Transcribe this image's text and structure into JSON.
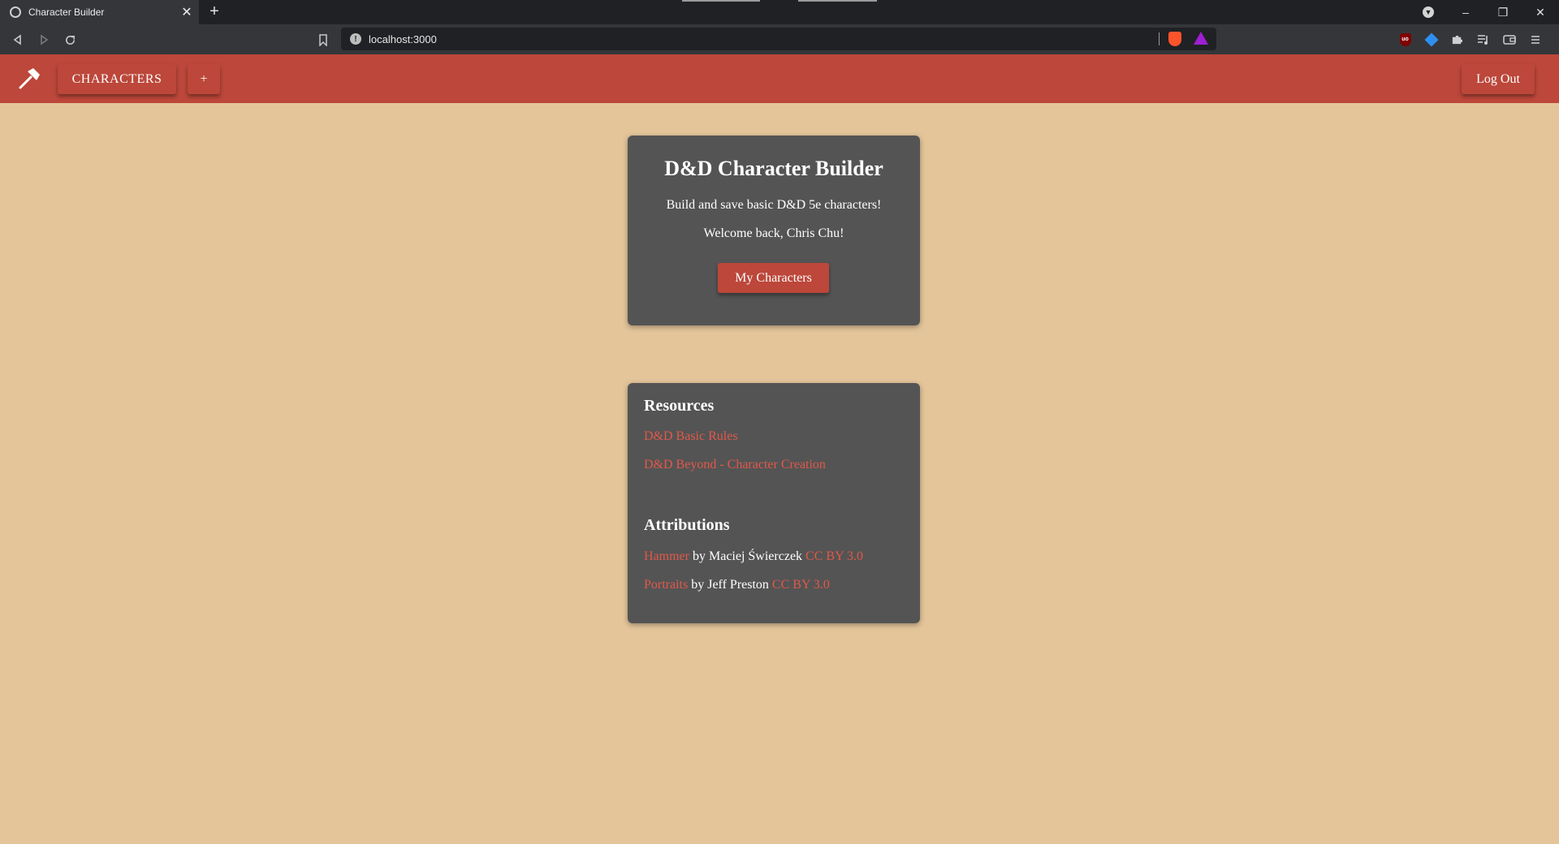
{
  "browser": {
    "tab_title": "Character Builder",
    "tab_close": "✕",
    "new_tab": "+",
    "url": "localhost:3000",
    "window_controls": {
      "minimize": "–",
      "restore": "❐",
      "close": "✕"
    }
  },
  "app_header": {
    "nav_characters": "CHARACTERS",
    "nav_add": "+",
    "logout": "Log Out"
  },
  "hero": {
    "title": "D&D Character Builder",
    "subtitle": "Build and save basic D&D 5e characters!",
    "welcome": "Welcome back, Chris Chu!",
    "button": "My Characters"
  },
  "resources": {
    "heading": "Resources",
    "links": [
      "D&D Basic Rules",
      "D&D Beyond - Character Creation"
    ]
  },
  "attributions": {
    "heading": "Attributions",
    "items": [
      {
        "work": "Hammer",
        "by": " by Maciej Świerczek ",
        "license": "CC BY 3.0"
      },
      {
        "work": "Portraits",
        "by": " by Jeff Preston ",
        "license": "CC BY 3.0"
      }
    ]
  },
  "colors": {
    "page_background": "#e4c59a",
    "header_red": "#bc473a",
    "card_gray": "#545454",
    "link_red": "#e2584a"
  }
}
